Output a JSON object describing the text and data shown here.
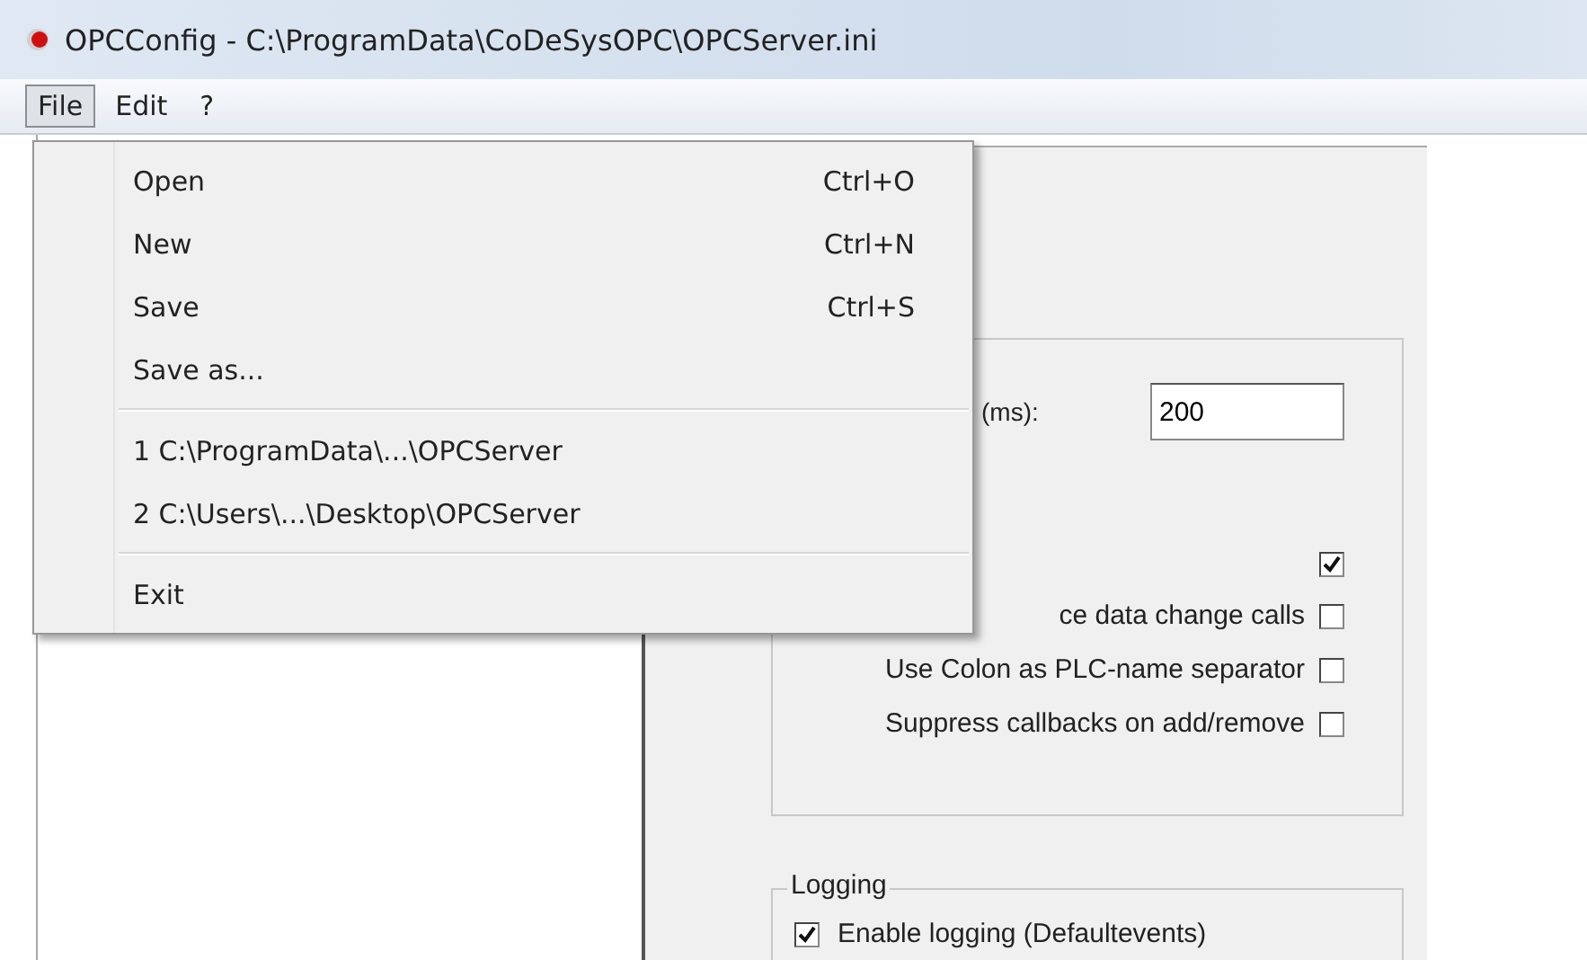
{
  "window": {
    "title": "OPCConfig - C:\\ProgramData\\CoDeSysOPC\\OPCServer.ini"
  },
  "menubar": [
    {
      "label": "File",
      "selected": true
    },
    {
      "label": "Edit",
      "selected": false
    },
    {
      "label": "?",
      "selected": false
    }
  ],
  "file_menu": {
    "items": [
      {
        "kind": "item",
        "label": "Open",
        "shortcut": "Ctrl+O"
      },
      {
        "kind": "item",
        "label": "New",
        "shortcut": "Ctrl+N"
      },
      {
        "kind": "item",
        "label": "Save",
        "shortcut": "Ctrl+S"
      },
      {
        "kind": "item",
        "label": "Save as..."
      },
      {
        "kind": "separator"
      },
      {
        "kind": "item",
        "label": "1 C:\\ProgramData\\...\\OPCServer"
      },
      {
        "kind": "item",
        "label": "2 C:\\Users\\...\\Desktop\\OPCServer"
      },
      {
        "kind": "separator"
      },
      {
        "kind": "item",
        "label": "Exit"
      }
    ]
  },
  "settings": {
    "interval_label": "(ms):",
    "interval_value": "200",
    "options": [
      {
        "checked": true
      },
      {
        "label": "ce data change calls",
        "checked": false
      },
      {
        "label": "Use Colon as PLC-name separator",
        "checked": false
      },
      {
        "label": "Suppress callbacks on add/remove",
        "checked": false
      }
    ]
  },
  "logging": {
    "title": "Logging",
    "options": [
      {
        "label": "Enable logging (Defaultevents)",
        "checked": true
      }
    ]
  }
}
